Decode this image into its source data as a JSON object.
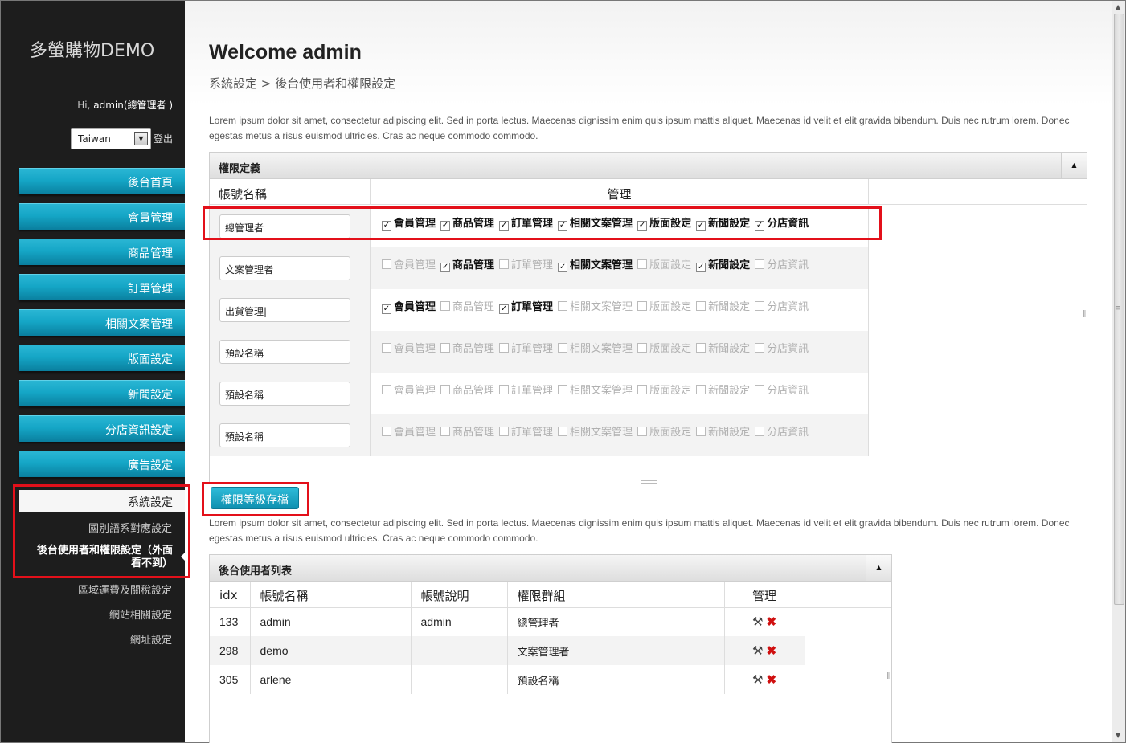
{
  "sidebar": {
    "brand": "多螢購物DEMO",
    "greeting_prefix": "Hi,",
    "greeting_user": "admin(總管理者 )",
    "language_value": "Taiwan",
    "logout_label": "登出",
    "nav_items": [
      {
        "label": "後台首頁"
      },
      {
        "label": "會員管理"
      },
      {
        "label": "商品管理"
      },
      {
        "label": "訂單管理"
      },
      {
        "label": "相關文案管理"
      },
      {
        "label": "版面設定"
      },
      {
        "label": "新聞設定"
      },
      {
        "label": "分店資訊設定"
      },
      {
        "label": "廣告設定"
      }
    ],
    "active_item": "系統設定",
    "sub_items": {
      "language_mapping": "國別語系對應設定",
      "current": "後台使用者和權限設定（外面看不到）",
      "shipping": "區域運費及關稅設定",
      "site": "網站相關設定",
      "url": "網址設定"
    }
  },
  "main": {
    "title": "Welcome admin",
    "breadcrumb": "系統設定 > 後台使用者和權限設定",
    "lorem_1": "Lorem ipsum dolor sit amet, consectetur adipiscing elit. Sed in porta lectus. Maecenas dignissim enim quis ipsum mattis aliquet. Maecenas id velit et elit gravida bibendum. Duis nec rutrum lorem. Donec egestas metus a risus euismod ultricies. Cras ac neque commodo commodo.",
    "lorem_2": "Lorem ipsum dolor sit amet, consectetur adipiscing elit. Sed in porta lectus. Maecenas dignissim enim quis ipsum mattis aliquet. Maecenas id velit et elit gravida bibendum. Duis nec rutrum lorem. Donec egestas metus a risus euismod ultricies. Cras ac neque commodo commodo."
  },
  "permissions": {
    "panel_title": "權限定義",
    "col_name": "帳號名稱",
    "col_manage": "管理",
    "perm_labels": [
      "會員管理",
      "商品管理",
      "訂單管理",
      "相關文案管理",
      "版面設定",
      "新聞設定",
      "分店資訊"
    ],
    "rows": [
      {
        "name": "總管理者",
        "checked": [
          true,
          true,
          true,
          true,
          true,
          true,
          true
        ]
      },
      {
        "name": "文案管理者",
        "checked": [
          false,
          true,
          false,
          true,
          false,
          true,
          false
        ]
      },
      {
        "name": "出貨管理|",
        "checked": [
          true,
          false,
          true,
          false,
          false,
          false,
          false
        ]
      },
      {
        "name": "預設名稱",
        "checked": [
          false,
          false,
          false,
          false,
          false,
          false,
          false
        ]
      },
      {
        "name": "預設名稱",
        "checked": [
          false,
          false,
          false,
          false,
          false,
          false,
          false
        ]
      },
      {
        "name": "預設名稱",
        "checked": [
          false,
          false,
          false,
          false,
          false,
          false,
          false
        ]
      }
    ],
    "save_label": "權限等級存檔"
  },
  "users": {
    "panel_title": "後台使用者列表",
    "headers": [
      "idx",
      "帳號名稱",
      "帳號說明",
      "權限群組",
      "管理"
    ],
    "rows": [
      {
        "idx": "133",
        "account": "admin",
        "desc": "admin",
        "group": "總管理者"
      },
      {
        "idx": "298",
        "account": "demo",
        "desc": "",
        "group": "文案管理者"
      },
      {
        "idx": "305",
        "account": "arlene",
        "desc": "",
        "group": "預設名稱"
      }
    ]
  },
  "icons": {
    "collapse": "triangle-up-icon",
    "edit": "tools-icon",
    "delete": "delete-x-icon",
    "select_arrow": "triangle-down-icon"
  },
  "colors": {
    "nav_accent": "#15a6c6",
    "highlight_box": "#e3101a",
    "sidebar_bg": "#1d1d1d",
    "delete": "#d01010"
  }
}
